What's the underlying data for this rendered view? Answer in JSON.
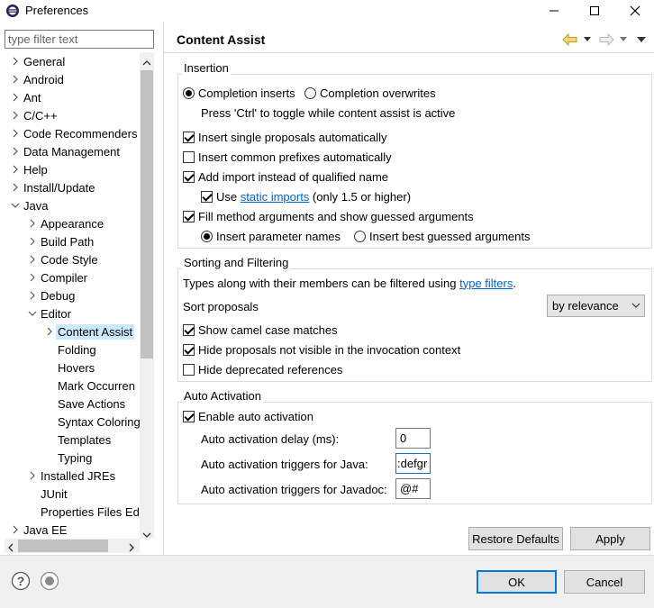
{
  "window": {
    "title": "Preferences",
    "controls": [
      "minimize",
      "maximize",
      "close"
    ]
  },
  "filter": {
    "placeholder": "type filter text",
    "value": ""
  },
  "tree": [
    {
      "label": "General",
      "depth": 0,
      "expander": "collapsed"
    },
    {
      "label": "Android",
      "depth": 0,
      "expander": "collapsed"
    },
    {
      "label": "Ant",
      "depth": 0,
      "expander": "collapsed"
    },
    {
      "label": "C/C++",
      "depth": 0,
      "expander": "collapsed"
    },
    {
      "label": "Code Recommenders",
      "depth": 0,
      "expander": "collapsed"
    },
    {
      "label": "Data Management",
      "depth": 0,
      "expander": "collapsed"
    },
    {
      "label": "Help",
      "depth": 0,
      "expander": "collapsed"
    },
    {
      "label": "Install/Update",
      "depth": 0,
      "expander": "collapsed"
    },
    {
      "label": "Java",
      "depth": 0,
      "expander": "expanded"
    },
    {
      "label": "Appearance",
      "depth": 1,
      "expander": "collapsed"
    },
    {
      "label": "Build Path",
      "depth": 1,
      "expander": "collapsed"
    },
    {
      "label": "Code Style",
      "depth": 1,
      "expander": "collapsed"
    },
    {
      "label": "Compiler",
      "depth": 1,
      "expander": "collapsed"
    },
    {
      "label": "Debug",
      "depth": 1,
      "expander": "collapsed"
    },
    {
      "label": "Editor",
      "depth": 1,
      "expander": "expanded"
    },
    {
      "label": "Content Assist",
      "depth": 2,
      "expander": "collapsed",
      "selected": true
    },
    {
      "label": "Folding",
      "depth": 2,
      "expander": "none"
    },
    {
      "label": "Hovers",
      "depth": 2,
      "expander": "none"
    },
    {
      "label": "Mark Occurren",
      "depth": 2,
      "expander": "none"
    },
    {
      "label": "Save Actions",
      "depth": 2,
      "expander": "none"
    },
    {
      "label": "Syntax Coloring",
      "depth": 2,
      "expander": "none"
    },
    {
      "label": "Templates",
      "depth": 2,
      "expander": "none"
    },
    {
      "label": "Typing",
      "depth": 2,
      "expander": "none"
    },
    {
      "label": "Installed JREs",
      "depth": 1,
      "expander": "collapsed"
    },
    {
      "label": "JUnit",
      "depth": 1,
      "expander": "none"
    },
    {
      "label": "Properties Files Ed",
      "depth": 1,
      "expander": "none"
    },
    {
      "label": "Java EE",
      "depth": 0,
      "expander": "collapsed"
    }
  ],
  "page": {
    "title": "Content Assist",
    "nav": [
      "back-icon",
      "back-menu-icon",
      "forward-icon",
      "forward-menu-icon",
      "view-menu-icon"
    ]
  },
  "insertion": {
    "title": "Insertion",
    "completion_inserts": {
      "label": "Completion inserts",
      "checked": true
    },
    "completion_overwrites": {
      "label": "Completion overwrites",
      "checked": false
    },
    "toggle_hint": "Press 'Ctrl' to toggle while content assist is active",
    "insert_single": {
      "label": "Insert single proposals automatically",
      "checked": true
    },
    "insert_common": {
      "label": "Insert common prefixes automatically",
      "checked": false
    },
    "add_import": {
      "label": "Add import instead of qualified name",
      "checked": true
    },
    "use_static": {
      "label_pre": "Use ",
      "link": "static imports",
      "label_post": " (only 1.5 or higher)",
      "checked": true
    },
    "fill_method": {
      "label": "Fill method arguments and show guessed arguments",
      "checked": true
    },
    "insert_param_names": {
      "label": "Insert parameter names",
      "checked": true
    },
    "insert_best_guessed": {
      "label": "Insert best guessed arguments",
      "checked": false
    }
  },
  "sorting": {
    "title": "Sorting and Filtering",
    "desc_pre": "Types along with their members can be filtered using ",
    "desc_link": "type filters",
    "desc_post": ".",
    "sort_label": "Sort proposals",
    "sort_value": "by relevance",
    "camel": {
      "label": "Show camel case matches",
      "checked": true
    },
    "hide_not_visible": {
      "label": "Hide proposals not visible in the invocation context",
      "checked": true
    },
    "hide_deprecated": {
      "label": "Hide deprecated references",
      "checked": false
    }
  },
  "auto": {
    "title": "Auto Activation",
    "enable": {
      "label": "Enable auto activation",
      "checked": true
    },
    "delay_label": "Auto activation delay (ms):",
    "delay_value": "0",
    "java_label": "Auto activation triggers for Java:",
    "java_value": ":defgr",
    "javadoc_label": "Auto activation triggers for Javadoc:",
    "javadoc_value": "@#"
  },
  "buttons": {
    "restore": "Restore Defaults",
    "apply": "Apply",
    "ok": "OK",
    "cancel": "Cancel"
  },
  "footer_icons": [
    "help-icon",
    "import-export-icon"
  ],
  "colors": {
    "link": "#0066cc",
    "selection": "#cce8ff",
    "default_button_border": "#0078d7"
  }
}
